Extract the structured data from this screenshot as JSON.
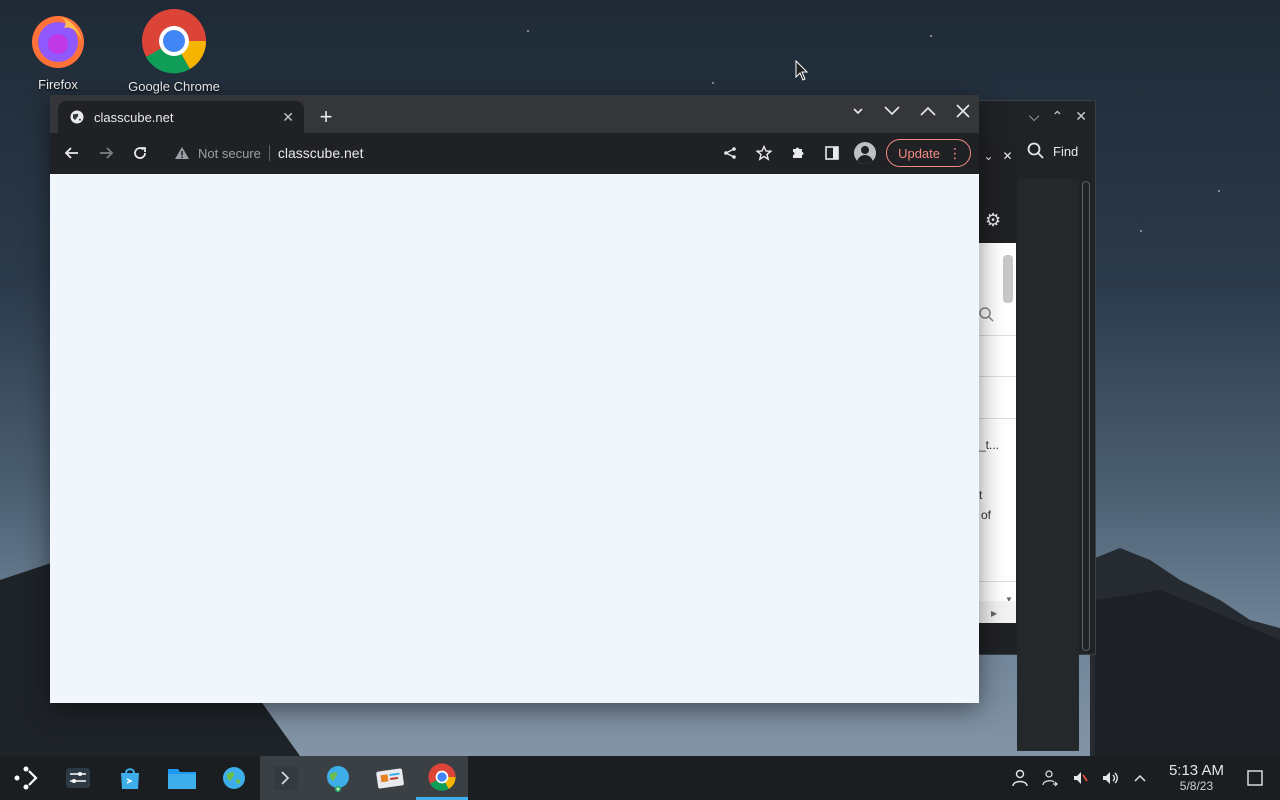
{
  "desktop": {
    "icons": [
      {
        "label": "Firefox",
        "icon": "firefox-icon"
      },
      {
        "label": "Google Chrome",
        "icon": "chrome-icon"
      }
    ]
  },
  "back_window": {
    "find_label": "Find",
    "fragments": [
      "_t...",
      "t",
      "of"
    ]
  },
  "browser": {
    "tab": {
      "title": "classcube.net"
    },
    "security_label": "Not secure",
    "url": "classcube.net",
    "update_label": "Update"
  },
  "taskbar": {
    "time": "5:13 AM",
    "date": "5/8/23"
  },
  "colors": {
    "chrome_dark": "#202124",
    "tabstrip": "#35363a",
    "page_bg": "#f1f5fc",
    "update_accent": "#f28b82",
    "taskbar": "#1b1e20",
    "active_indicator": "#3daee9"
  }
}
